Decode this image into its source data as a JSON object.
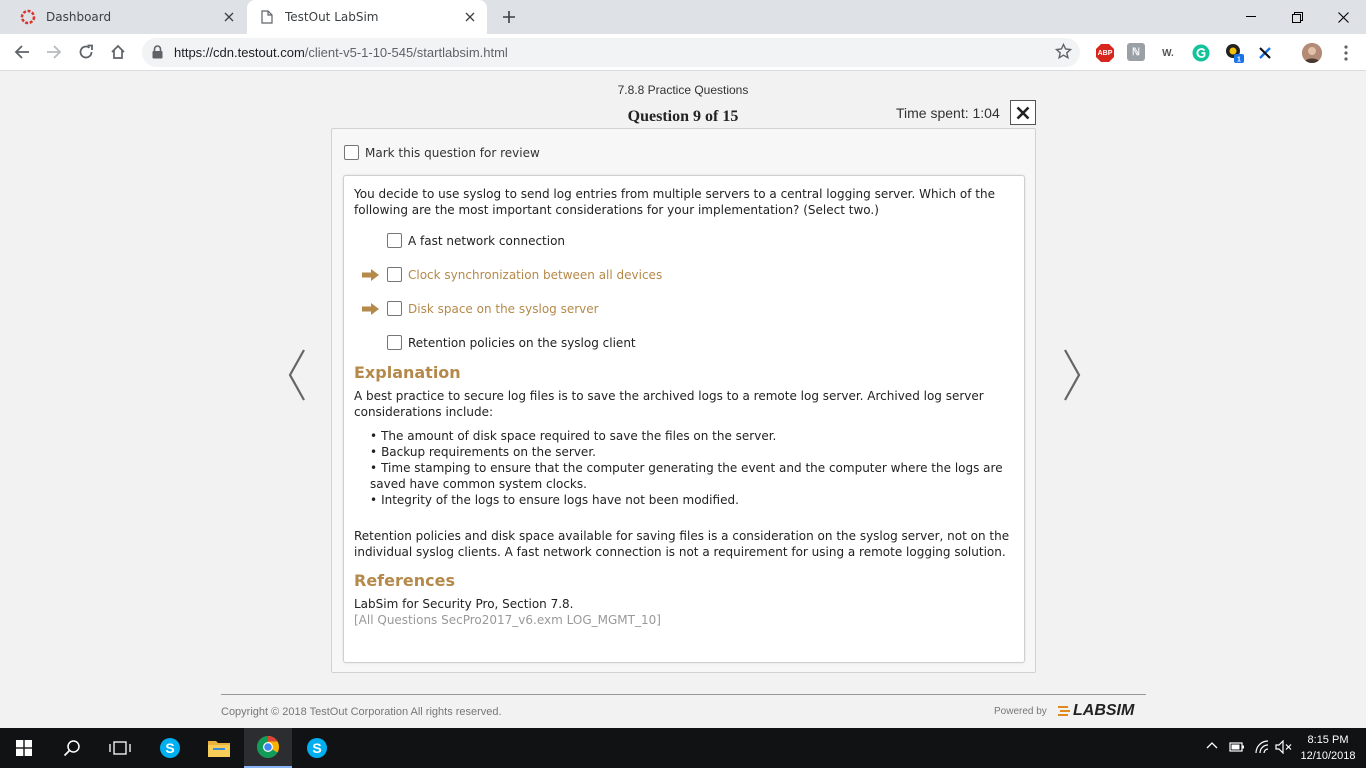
{
  "browser": {
    "tabs": [
      {
        "title": "Dashboard",
        "icon": "dashboard-favicon",
        "active": false
      },
      {
        "title": "TestOut LabSim",
        "icon": "document-icon",
        "active": true
      }
    ],
    "url_host": "https://cdn.testout.com",
    "url_path": "/client-v5-1-10-545/startlabsim.html",
    "extensions": [
      "ABP",
      "W."
    ]
  },
  "quiz": {
    "section_title": "7.8.8 Practice Questions",
    "question_label": "Question 9 of 15",
    "time_spent": "Time spent: 1:04",
    "mark_review_label": "Mark this question for review",
    "question_text": "You decide to use syslog to send log entries from multiple servers to a central logging server. Which of the following are the most important considerations for your implementation? (Select two.)",
    "options": [
      {
        "label": "A fast network connection",
        "correct": false
      },
      {
        "label": "Clock synchronization between all devices",
        "correct": true
      },
      {
        "label": "Disk space on the syslog server",
        "correct": true
      },
      {
        "label": "Retention policies on the syslog client",
        "correct": false
      }
    ],
    "explanation_heading": "Explanation",
    "explanation_intro": "A best practice to secure log files is to save the archived logs to a remote log server. Archived log server considerations include:",
    "explanation_bullets": [
      "The amount of disk space required to save the files on the server.",
      "Backup requirements on the server.",
      "Time stamping to ensure that the computer generating the event and the computer where the logs are saved have common system clocks.",
      "Integrity of the logs to ensure logs have not been modified."
    ],
    "explanation_outro": "Retention policies and disk space available for saving files is a consideration on the syslog server, not on the individual syslog clients. A fast network connection is not a requirement for using a remote logging solution.",
    "references_heading": "References",
    "reference_1": "LabSim for Security Pro, Section 7.8.",
    "reference_2": "[All Questions SecPro2017_v6.exm LOG_MGMT_10]"
  },
  "footer": {
    "copyright": "Copyright © 2018  TestOut Corporation All rights reserved.",
    "powered_by": "Powered by",
    "brand": "LABSIM"
  },
  "taskbar": {
    "time": "8:15 PM",
    "date": "12/10/2018"
  },
  "colors": {
    "accent": "#b5894a",
    "taskbar": "#111214"
  }
}
